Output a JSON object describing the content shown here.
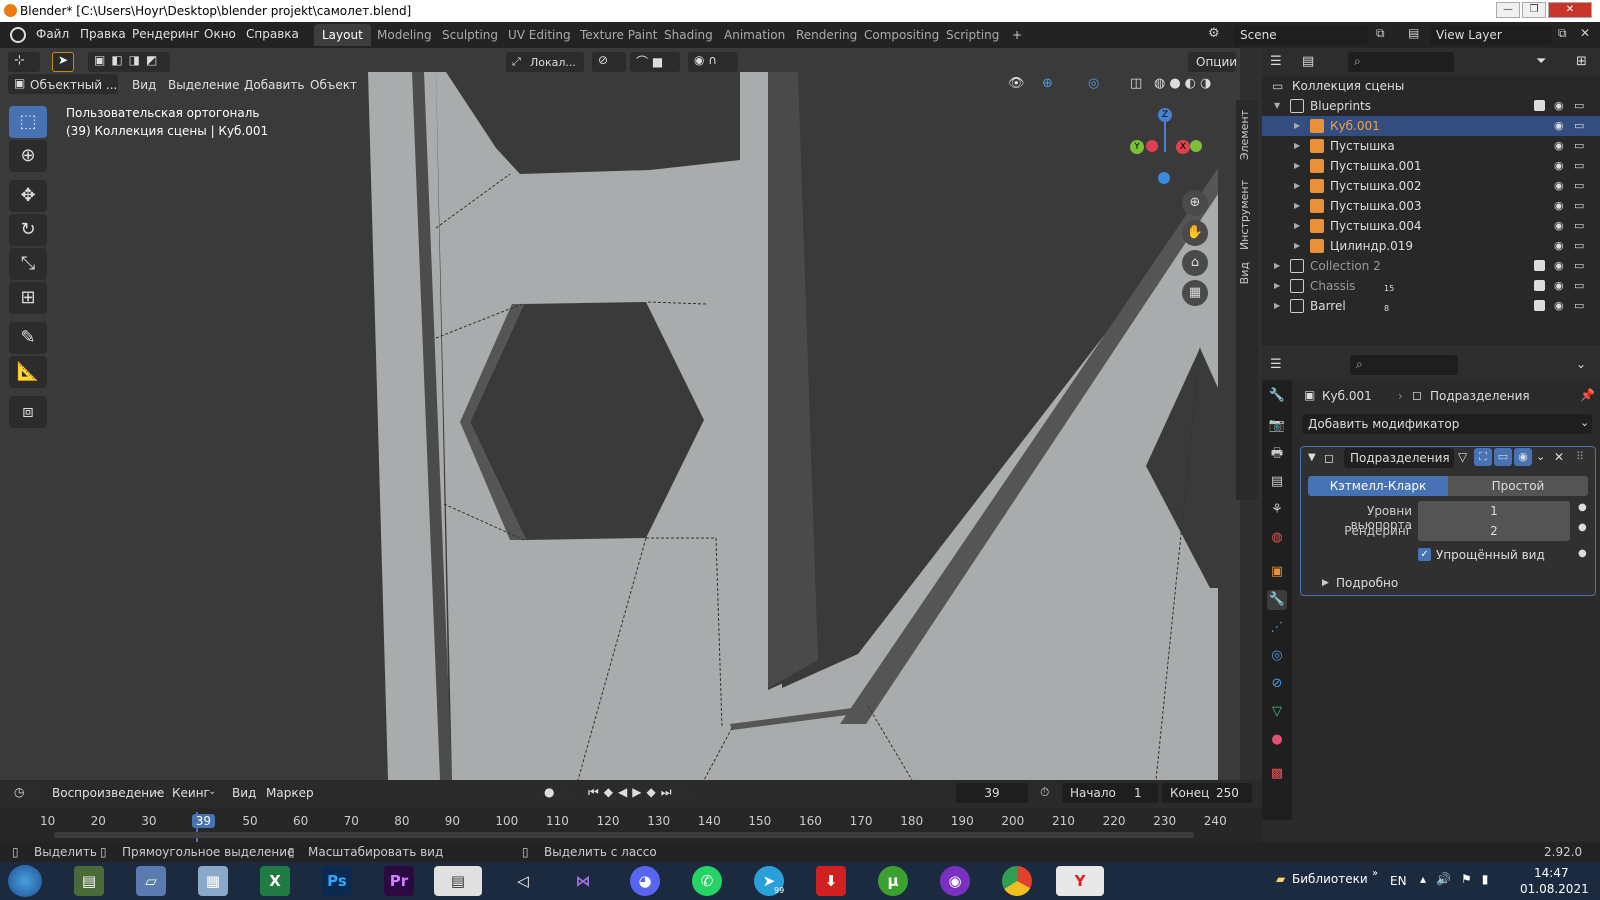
{
  "window": {
    "title": "Blender* [C:\\Users\\Hoyr\\Desktop\\blender projekt\\самолет.blend]",
    "minimize": "—",
    "restore": "❐",
    "close": "✕"
  },
  "menu": [
    "Файл",
    "Правка",
    "Рендеринг",
    "Окно",
    "Справка"
  ],
  "workspaces": [
    "Layout",
    "Modeling",
    "Sculpting",
    "UV Editing",
    "Texture Paint",
    "Shading",
    "Animation",
    "Rendering",
    "Compositing",
    "Scripting"
  ],
  "add_workspace": "+",
  "scene": {
    "value": "Scene"
  },
  "view_layer": {
    "value": "View Layer"
  },
  "viewport_header": {
    "transform_orientation": "Локал...",
    "options": "Опции",
    "mode": "Объектный ...",
    "menus": [
      "Вид",
      "Выделение",
      "Добавить",
      "Объект"
    ]
  },
  "viewport": {
    "info_line1": "Пользовательская ортогональ",
    "info_line2": "(39) Коллекция сцены | Куб.001",
    "mesh_color": "#a8acad",
    "bg_color": "#3a3a3a",
    "gizmo": {
      "z": "Z",
      "y": "Y",
      "x": "X"
    }
  },
  "n_panel_tabs": [
    "Элемент",
    "Инструмент",
    "Вид"
  ],
  "outliner": {
    "root": "Коллекция сцены",
    "rows": [
      {
        "label": "Blueprints",
        "kind": "collection"
      },
      {
        "label": "Куб.001",
        "kind": "mesh",
        "selected": true
      },
      {
        "label": "Пустышка",
        "kind": "empty"
      },
      {
        "label": "Пустышка.001",
        "kind": "empty"
      },
      {
        "label": "Пустышка.002",
        "kind": "empty"
      },
      {
        "label": "Пустышка.003",
        "kind": "empty"
      },
      {
        "label": "Пустышка.004",
        "kind": "empty"
      },
      {
        "label": "Цилиндр.019",
        "kind": "mesh"
      },
      {
        "label": "Collection 2",
        "kind": "collection",
        "dim": true
      },
      {
        "label": "Chassis",
        "kind": "collection",
        "dim": true,
        "count": "15"
      },
      {
        "label": "Barrel",
        "kind": "collection",
        "count": "8"
      }
    ]
  },
  "properties": {
    "object": "Куб.001",
    "modifier_breadcrumb": "Подразделения",
    "add_modifier": "Добавить модификатор",
    "modifier_name": "Подразделения",
    "type_catmull": "Кэтмелл-Кларк",
    "type_simple": "Простой",
    "levels_viewport_label": "Уровни вьюпорта",
    "levels_viewport_value": "1",
    "render_label": "Рендеринг",
    "render_value": "2",
    "simplified_label": "Упрощённый вид",
    "advanced_label": "Подробно"
  },
  "timeline": {
    "menus": [
      "Воспроизведение",
      "Кеинг",
      "Вид",
      "Маркер"
    ],
    "current_frame": "39",
    "start_label": "Начало",
    "start_value": "1",
    "end_label": "Конец",
    "end_value": "250",
    "ticks": [
      "10",
      "20",
      "30",
      "39",
      "50",
      "60",
      "70",
      "80",
      "90",
      "100",
      "110",
      "120",
      "130",
      "140",
      "150",
      "160",
      "170",
      "180",
      "190",
      "200",
      "210",
      "220",
      "230",
      "240"
    ]
  },
  "status_bar": {
    "select": "Выделить",
    "box_select": "Прямоугольное выделение",
    "zoom": "Масштабировать вид",
    "lasso": "Выделить с лассо",
    "version": "2.92.0"
  },
  "taskbar": {
    "libraries": "Библиотеки",
    "lang": "EN",
    "time": "14:47",
    "date": "01.08.2021",
    "telegram_badge": "99",
    "apps": [
      "start",
      "explorer",
      "folder",
      "calculator",
      "excel",
      "photoshop",
      "premiere",
      "notepad",
      "unity",
      "visual-studio",
      "discord",
      "whatsapp",
      "telegram",
      "downloader",
      "utorrent",
      "audio",
      "chrome",
      "yandex"
    ]
  }
}
